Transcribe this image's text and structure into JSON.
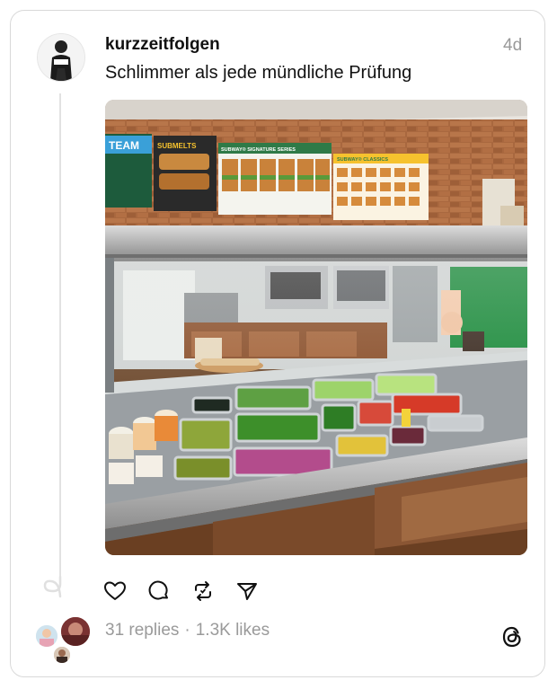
{
  "post": {
    "username": "kurzzeitfolgen",
    "timestamp": "4d",
    "text": "Schlimmer als jede mündliche Prüfung"
  },
  "stats": {
    "replies": "31 replies",
    "separator": "·",
    "likes": "1.3K likes"
  },
  "actions": [
    "heart-icon",
    "comment-icon",
    "repost-icon",
    "share-icon"
  ],
  "image_signs": {
    "team": "TEAM",
    "submelts": "SUBMELTS",
    "signature": "SUBWAY® SIGNATURE SERIES",
    "classics": "SUBWAY® CLASSICS"
  },
  "colors": {
    "accent_text": "#111111",
    "muted_text": "#9a9a9a",
    "border": "#d9d9d9"
  }
}
